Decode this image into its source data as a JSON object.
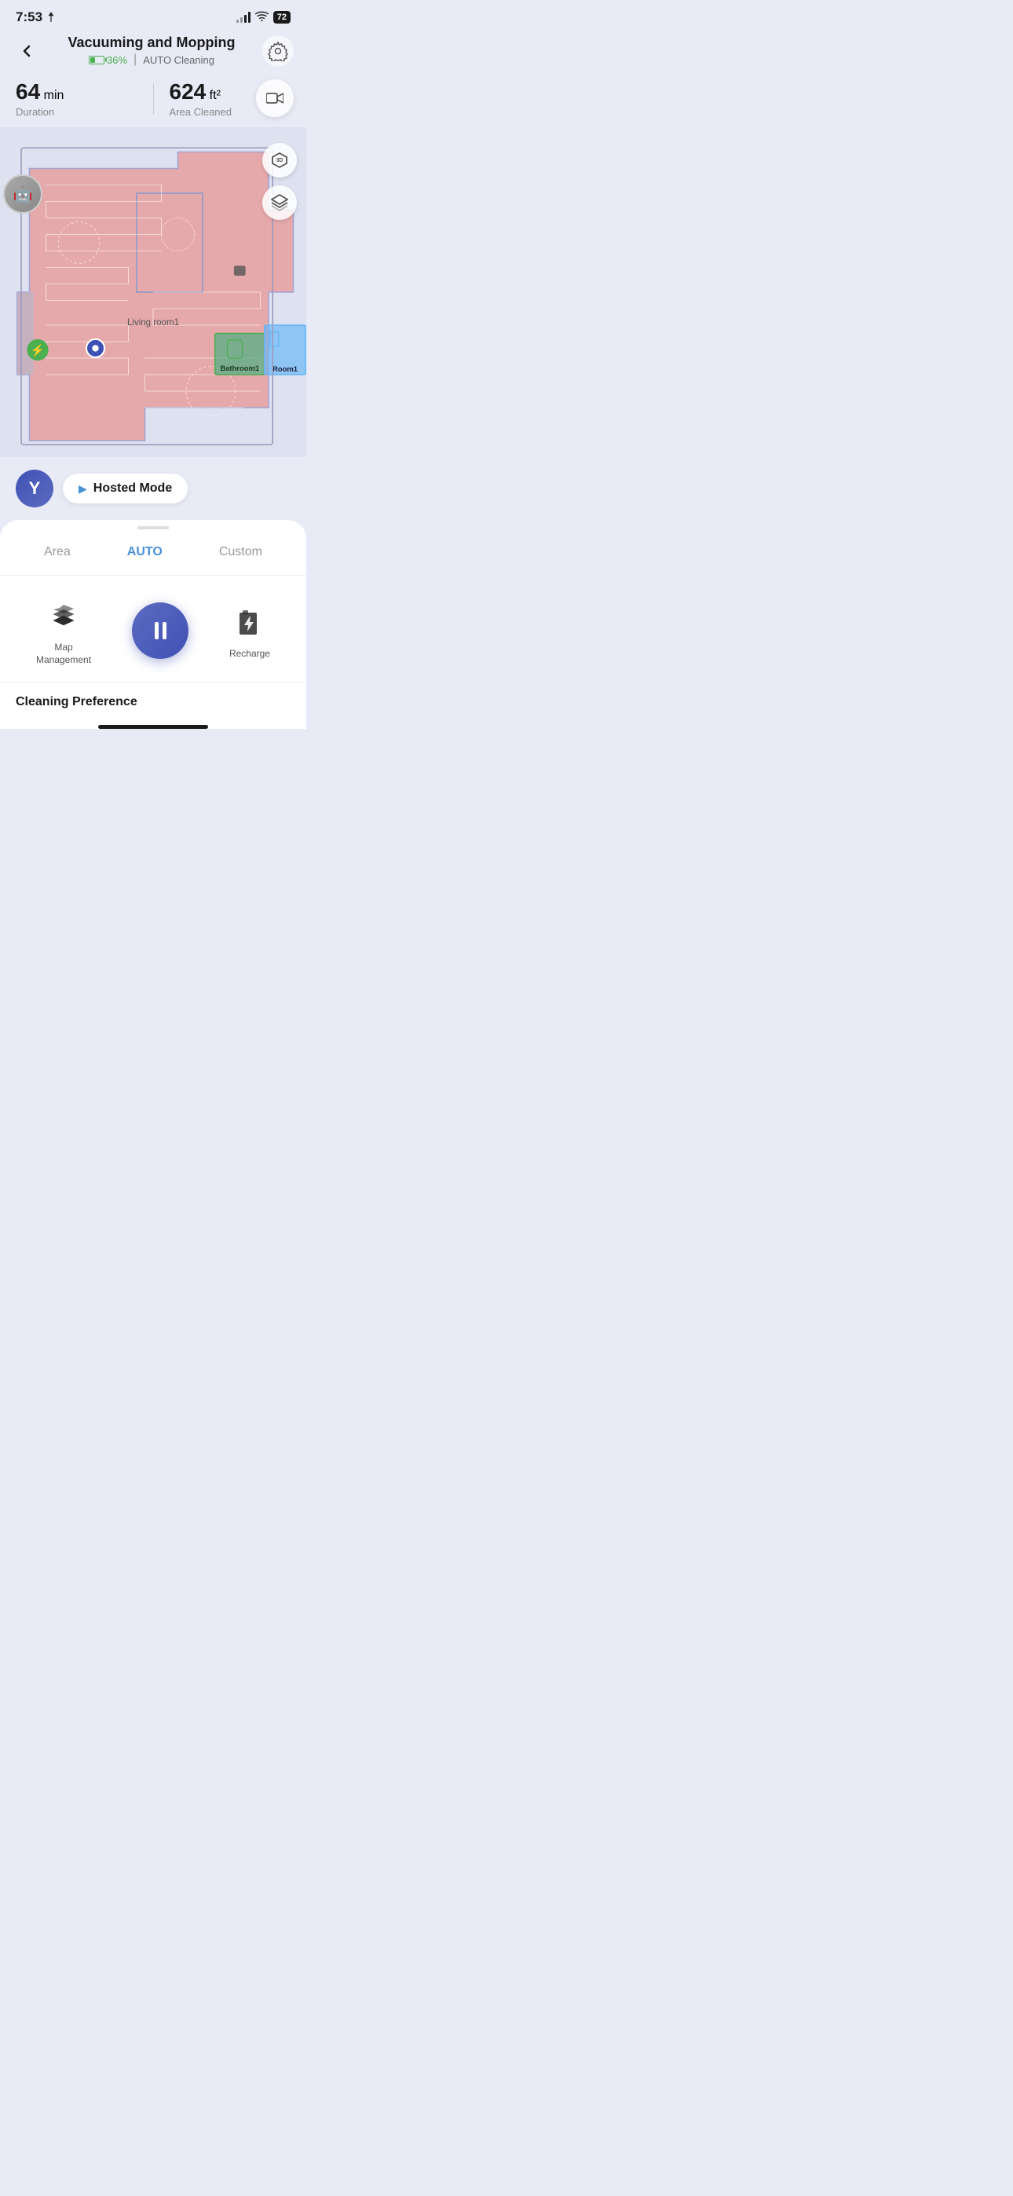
{
  "statusBar": {
    "time": "7:53",
    "battery": "72"
  },
  "header": {
    "title": "Vacuuming and Mopping",
    "backLabel": "<",
    "batteryPct": "36%",
    "cleaningMode": "AUTO Cleaning"
  },
  "stats": {
    "duration": "64",
    "durationUnit": "min",
    "durationLabel": "Duration",
    "area": "624",
    "areaUnit": "ft²",
    "areaLabel": "Area Cleaned"
  },
  "map": {
    "roomLabels": {
      "livingRoom": "Living room1",
      "bathroom": "Bathroom1",
      "room1": "Room1"
    }
  },
  "hostedMode": {
    "label": "Hosted Mode",
    "avatarLetter": "Y"
  },
  "bottomPanel": {
    "tabs": [
      {
        "label": "Area",
        "active": false
      },
      {
        "label": "AUTO",
        "active": true
      },
      {
        "label": "Custom",
        "active": false
      }
    ],
    "controls": {
      "mapManagement": "Map\nManagement",
      "recharge": "Recharge"
    },
    "cleaningPreference": "Cleaning Preference"
  },
  "icons": {
    "back": "‹",
    "settings": "⬡",
    "video": "📹",
    "threeD": "3D",
    "layers": "◈",
    "play": "▶",
    "lightning": "⚡"
  }
}
